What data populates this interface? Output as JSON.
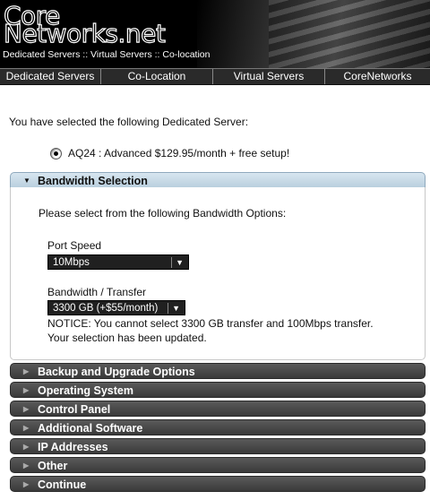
{
  "header": {
    "logo_line1": "Core",
    "logo_line2": "Networks.net",
    "tagline": "Dedicated Servers :: Virtual Servers :: Co-location"
  },
  "nav": {
    "items": [
      {
        "label": "Dedicated Servers"
      },
      {
        "label": "Co-Location"
      },
      {
        "label": "Virtual Servers"
      },
      {
        "label": "CoreNetworks"
      }
    ]
  },
  "selection": {
    "intro": "You have selected the following Dedicated Server:",
    "server_option": "AQ24 : Advanced $129.95/month + free setup!",
    "server_selected": true
  },
  "bandwidth_panel": {
    "title": "Bandwidth Selection",
    "instructions": "Please select from the following Bandwidth Options:",
    "port_speed_label": "Port Speed",
    "port_speed_value": "10Mbps",
    "transfer_label": "Bandwidth / Transfer",
    "transfer_value": "3300 GB (+$55/month)",
    "notice_line1": "NOTICE: You cannot select 3300 GB transfer and 100Mbps transfer.",
    "notice_line2": "Your selection has been updated."
  },
  "collapsed_panels": [
    {
      "title": "Backup and Upgrade Options"
    },
    {
      "title": "Operating System"
    },
    {
      "title": "Control Panel"
    },
    {
      "title": "Additional Software"
    },
    {
      "title": "IP Addresses"
    },
    {
      "title": "Other"
    },
    {
      "title": "Continue"
    }
  ],
  "colors": {
    "header_bg": "#000000",
    "nav_bg": "#2a2a2a",
    "open_panel": "#c5d8e6",
    "closed_panel": "#444444"
  },
  "icons": {
    "open_arrow": "triangle-down-icon",
    "closed_arrow": "triangle-right-icon",
    "select_caret": "caret-down-icon"
  }
}
